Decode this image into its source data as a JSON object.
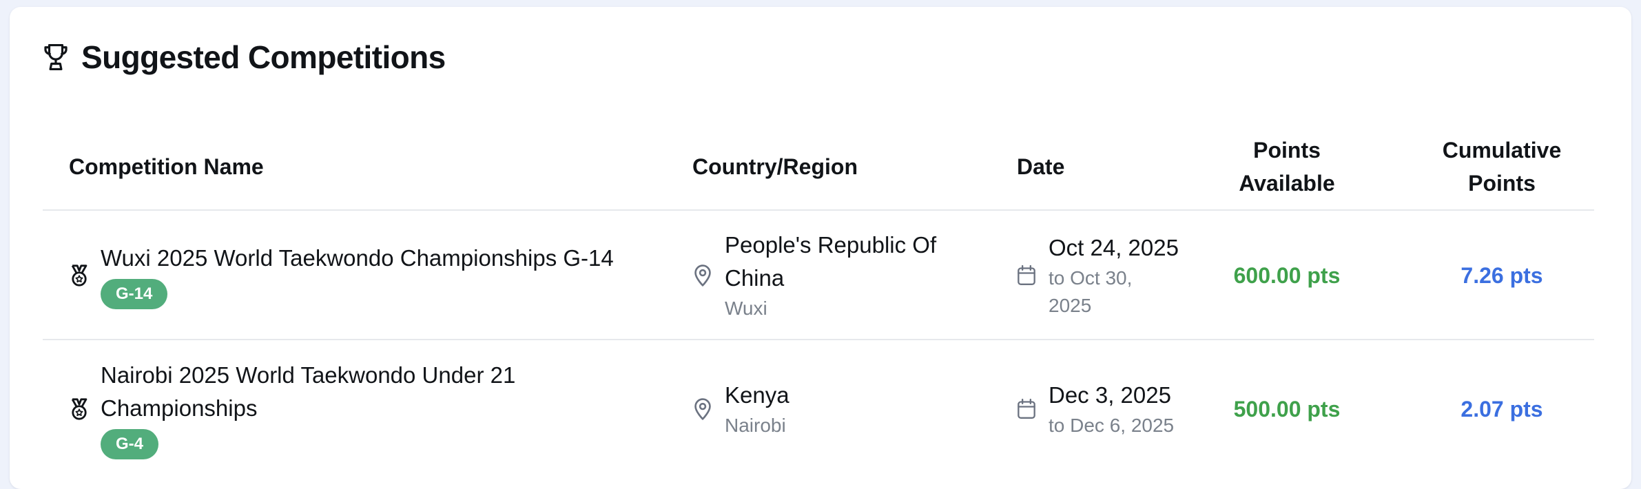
{
  "header": {
    "title": "Suggested Competitions",
    "icon": "trophy-icon"
  },
  "table": {
    "columns": [
      "Competition Name",
      "Country/Region",
      "Date",
      "Points Available",
      "Cumulative Points"
    ],
    "rows": [
      {
        "name": "Wuxi 2025 World Taekwondo Championships G-14",
        "badge": "G-14",
        "country": "People's Republic Of China",
        "city": "Wuxi",
        "date_start": "Oct 24, 2025",
        "date_end": "to Oct 30, 2025",
        "points_available": "600.00 pts",
        "cumulative_points": "7.26 pts"
      },
      {
        "name": "Nairobi 2025 World Taekwondo Under 21 Championships",
        "badge": "G-4",
        "country": "Kenya",
        "city": "Nairobi",
        "date_start": "Dec 3, 2025",
        "date_end": "to Dec 6, 2025",
        "points_available": "500.00 pts",
        "cumulative_points": "2.07 pts"
      }
    ]
  },
  "colors": {
    "badge": "#52ad7c",
    "points_available": "#3fa14b",
    "cumulative_points": "#3b6fe0",
    "muted_text": "#7a818b"
  }
}
